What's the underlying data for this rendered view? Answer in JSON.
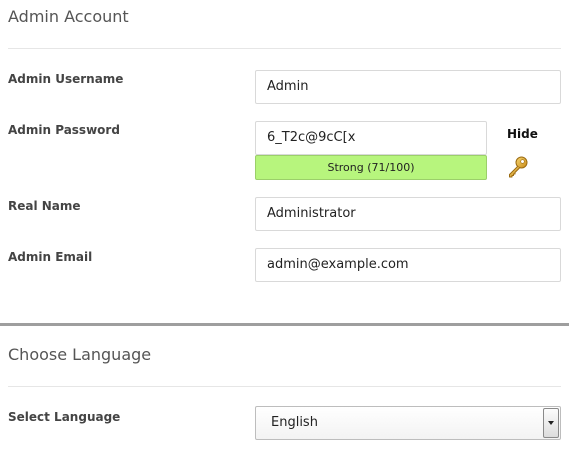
{
  "admin_account": {
    "title": "Admin Account",
    "username": {
      "label": "Admin Username",
      "value": "Admin"
    },
    "password": {
      "label": "Admin Password",
      "value": "6_T2c@9cC[x",
      "hide_label": "Hide",
      "strength_text": "Strong (71/100)",
      "strength_score": 71,
      "strength_color": "#b7f57d",
      "generate_icon": "key-icon"
    },
    "real_name": {
      "label": "Real Name",
      "value": "Administrator"
    },
    "email": {
      "label": "Admin Email",
      "value": "admin@example.com"
    }
  },
  "choose_language": {
    "title": "Choose Language",
    "select": {
      "label": "Select Language",
      "value": "English"
    }
  }
}
